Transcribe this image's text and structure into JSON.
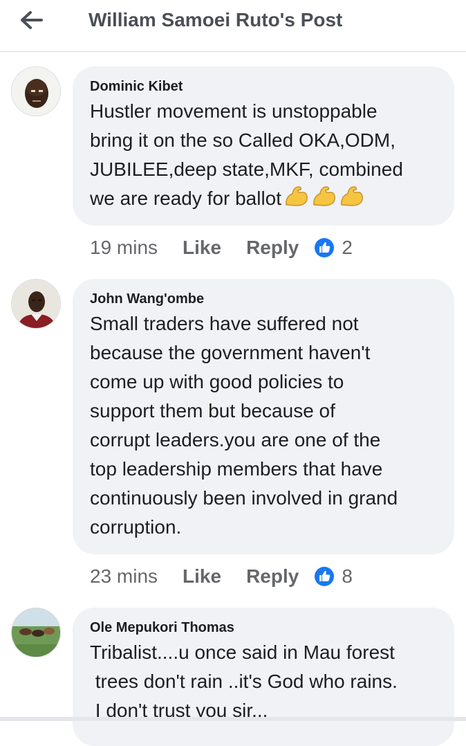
{
  "header": {
    "title": "William Samoei Ruto's Post",
    "back_icon": "arrow-left-icon"
  },
  "colors": {
    "bubble": "#f0f2f5",
    "like_blue": "#1877f2",
    "meta_gray": "#65676b"
  },
  "comments": [
    {
      "author": "Dominic Kibet",
      "text": "Hustler movement is unstoppable\nbring it on the so Called OKA,ODM,\nJUBILEE,deep state,MKF, combined\nwe are ready for ballot",
      "emoji": "flexed-biceps-icon",
      "time": "19 mins",
      "like_label": "Like",
      "reply_label": "Reply",
      "reaction_count": "2"
    },
    {
      "author": "John Wang'ombe",
      "text": "Small traders have suffered not\nbecause the government haven't\ncome up with good policies to\nsupport them but because of\ncorrupt leaders.you are one of the\ntop leadership members that have\ncontinuously been involved in grand\ncorruption.",
      "time": "23 mins",
      "like_label": "Like",
      "reply_label": "Reply",
      "reaction_count": "8"
    },
    {
      "author": "Ole Mepukori Thomas",
      "text": "Tribalist....u once said in Mau forest\n trees don't rain ..it's God who rains.\n I don't trust you sir..."
    }
  ]
}
